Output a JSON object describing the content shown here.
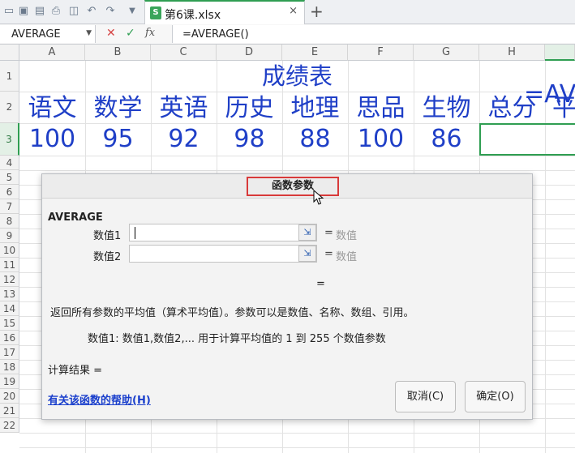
{
  "toolbar": {
    "icons": [
      "folder-icon",
      "save-icon",
      "save-as-icon",
      "print-icon",
      "print-preview-icon",
      "undo-icon",
      "redo-icon",
      "dropdown-icon"
    ]
  },
  "tab": {
    "label": "第6课.xlsx",
    "close": "×",
    "add": "+"
  },
  "formula_bar": {
    "name_box": "AVERAGE",
    "cancel": "✕",
    "confirm": "✓",
    "fx": "fx",
    "formula": "=AVERAGE()"
  },
  "grid": {
    "columns": [
      "A",
      "B",
      "C",
      "D",
      "E",
      "F",
      "G",
      "H"
    ],
    "rows": [
      "1",
      "2",
      "3",
      "4",
      "5",
      "6",
      "7",
      "8",
      "9",
      "10",
      "11",
      "12",
      "13",
      "14",
      "15",
      "16",
      "17",
      "18",
      "19",
      "20",
      "21",
      "22"
    ],
    "title": "成绩表",
    "headers": [
      "语文",
      "数学",
      "英语",
      "历史",
      "地理",
      "思品",
      "生物",
      "总分",
      "平"
    ],
    "scores": [
      "100",
      "95",
      "92",
      "98",
      "88",
      "100",
      "86"
    ],
    "active_cell_text": "=AVE"
  },
  "dialog": {
    "title": "函数参数",
    "function_name": "AVERAGE",
    "args": [
      {
        "label": "数值1",
        "eq": "=",
        "hint": "数值"
      },
      {
        "label": "数值2",
        "eq": "=",
        "hint": "数值"
      }
    ],
    "total_eq": "=",
    "description": "返回所有参数的平均值（算术平均值）。参数可以是数值、名称、数组、引用。",
    "arg_description": "数值1:   数值1,数值2,... 用于计算平均值的 1 到 255 个数值参数",
    "result_label": "计算结果  =",
    "help_link": "有关该函数的帮助(H)",
    "cancel_button": "取消(C)",
    "ok_button": "确定(O)"
  }
}
